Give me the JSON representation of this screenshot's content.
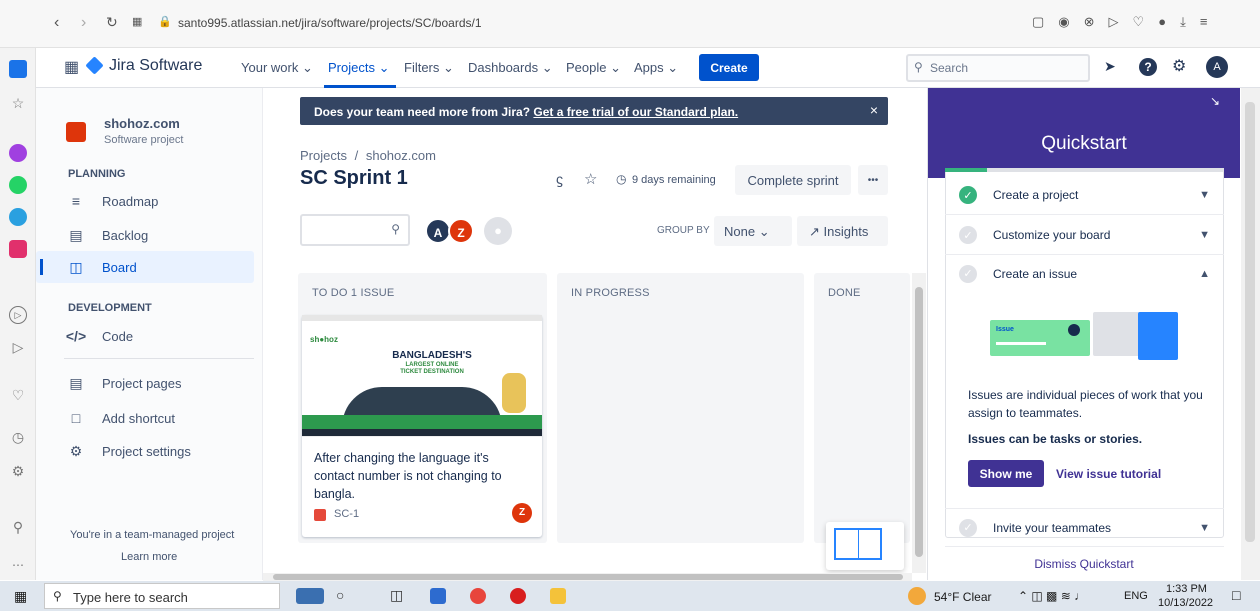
{
  "browser": {
    "url": "santo995.atlassian.net/jira/software/projects/SC/boards/1"
  },
  "topnav": {
    "product": "Jira Software",
    "menus": [
      "Your work",
      "Projects",
      "Filters",
      "Dashboards",
      "People",
      "Apps"
    ],
    "create_label": "Create",
    "search_placeholder": "Search",
    "avatar_initial": "A"
  },
  "sidebar": {
    "project_name": "shohoz.com",
    "project_type": "Software project",
    "planning_header": "PLANNING",
    "planning_items": [
      "Roadmap",
      "Backlog",
      "Board"
    ],
    "development_header": "DEVELOPMENT",
    "code_label": "Code",
    "other_items": [
      "Project pages",
      "Add shortcut",
      "Project settings"
    ],
    "footer_text": "You're in a team-managed project",
    "learn_more": "Learn more"
  },
  "banner": {
    "text": "Does your team need more from Jira?",
    "link": "Get a free trial of our Standard plan.",
    "close": "×"
  },
  "board": {
    "breadcrumb_root": "Projects",
    "breadcrumb_sep": "/",
    "breadcrumb_project": "shohoz.com",
    "title": "SC Sprint 1",
    "days_remaining": "9 days remaining",
    "complete_sprint": "Complete sprint",
    "more": "•••",
    "group_by_label": "GROUP BY",
    "group_by_value": "None",
    "insights": "Insights",
    "avatars": [
      {
        "initial": "A",
        "color": "#253858"
      },
      {
        "initial": "Z",
        "color": "#de350b"
      }
    ],
    "columns": [
      "TO DO 1 ISSUE",
      "IN PROGRESS",
      "DONE"
    ],
    "card": {
      "thumb_headline": "BANGLADESH'S",
      "thumb_sub1": "LARGEST ONLINE",
      "thumb_sub2": "TICKET DESTINATION",
      "summary": "After changing the language it's contact number is not changing to bangla.",
      "key": "SC-1",
      "assignee": "Z"
    }
  },
  "quickstart": {
    "title": "Quickstart",
    "items": [
      {
        "label": "Create a project",
        "done": true
      },
      {
        "label": "Customize your board",
        "done": false
      },
      {
        "label": "Create an issue",
        "done": false
      },
      {
        "label": "Invite your teammates",
        "done": false
      }
    ],
    "illustration_label": "Issue",
    "desc1": "Issues are individual pieces of work that you assign to teammates.",
    "desc2": "Issues can be tasks or stories.",
    "show_me": "Show me",
    "tutorial_link": "View issue tutorial",
    "dismiss": "Dismiss Quickstart"
  },
  "taskbar": {
    "search_placeholder": "Type here to search",
    "weather": "54°F  Clear",
    "lang": "ENG",
    "time": "1:33 PM",
    "date": "10/13/2022"
  },
  "colors": {
    "jira_blue": "#0052cc",
    "quickstart_purple": "#403294",
    "banner_dark": "#344563",
    "selected_bg": "#e9f2ff"
  }
}
